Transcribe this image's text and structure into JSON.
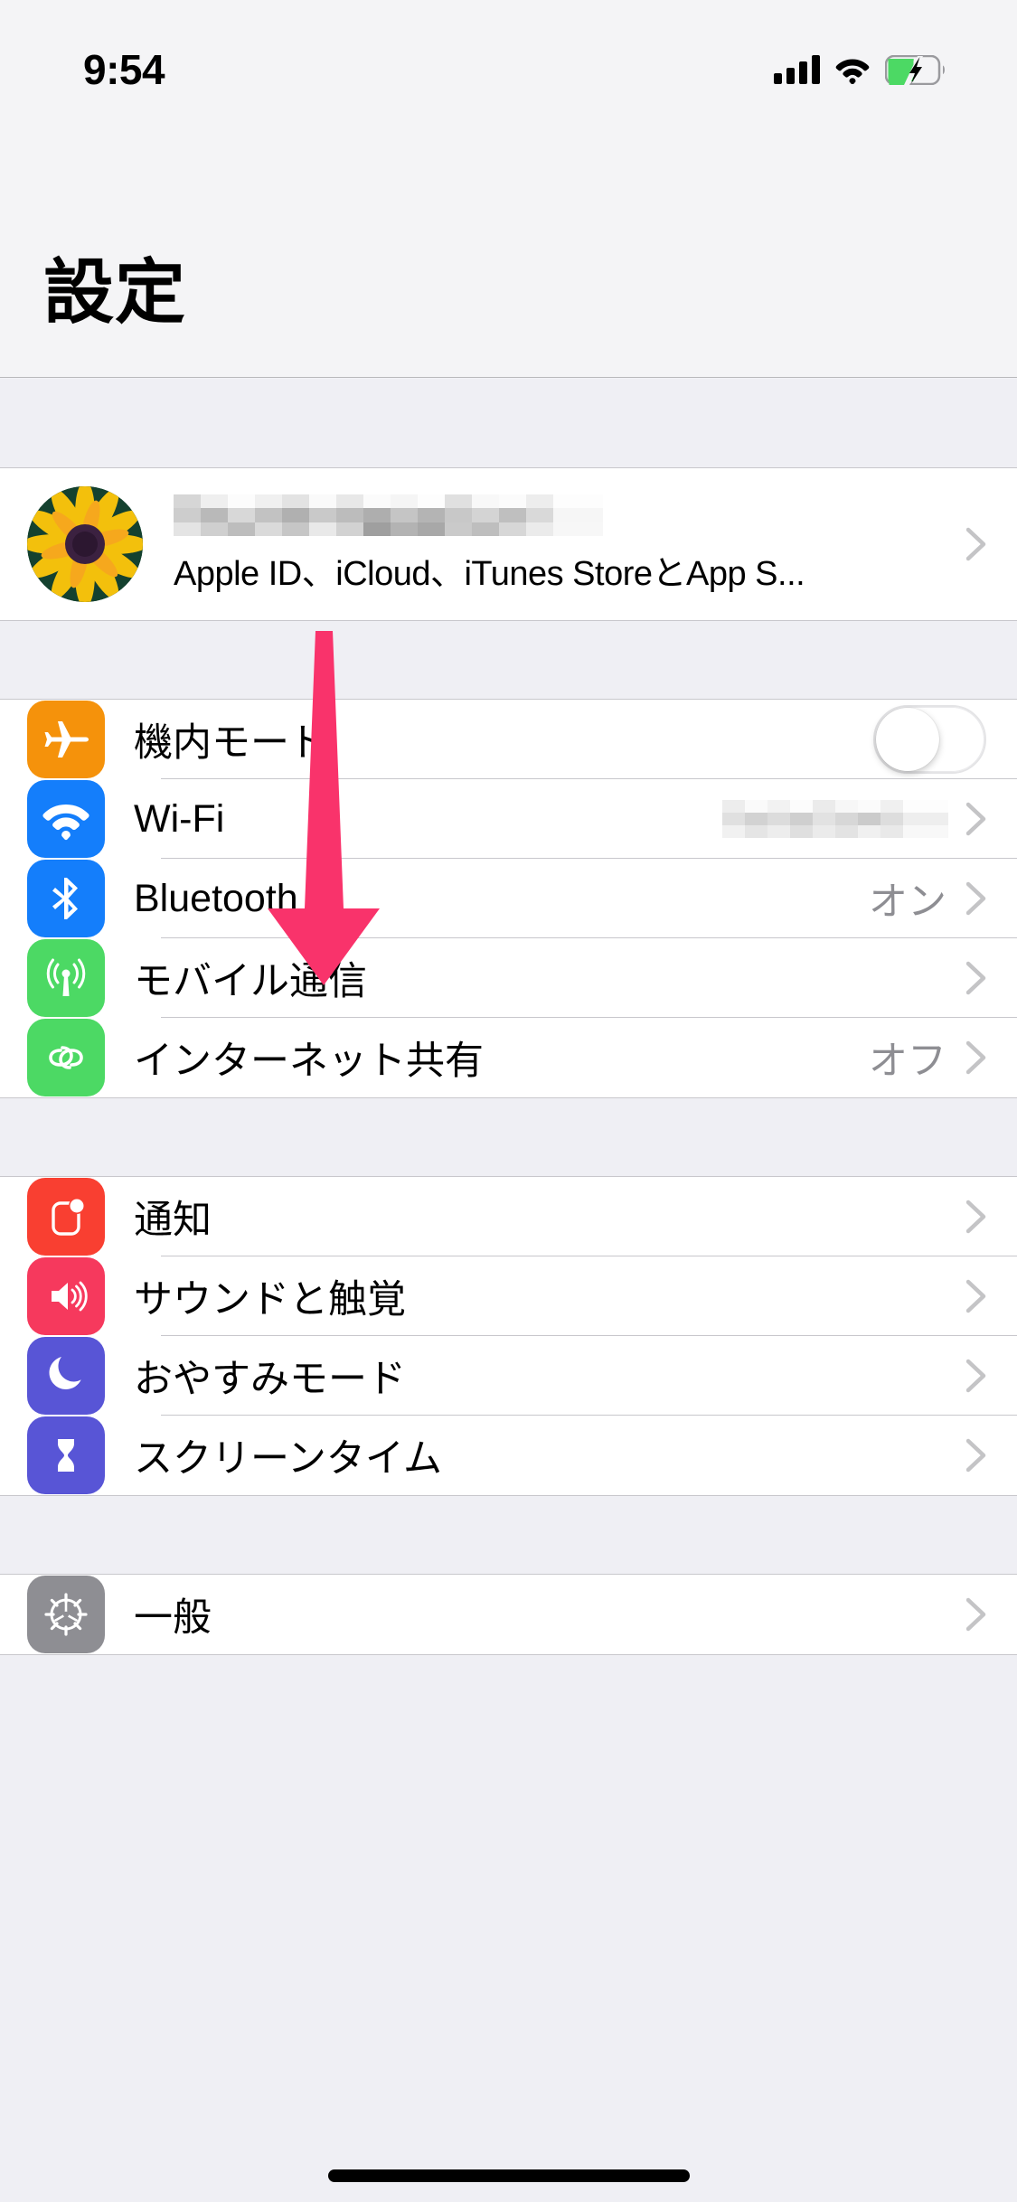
{
  "status_bar": {
    "time": "9:54",
    "signal_icon": "cellular-bars-icon",
    "wifi_icon": "wifi-icon",
    "battery_icon": "battery-charging-icon",
    "battery_color": "#4cd964"
  },
  "header": {
    "title": "設定"
  },
  "apple_id": {
    "avatar_icon": "sunflower-avatar",
    "name": "",
    "name_redacted": true,
    "subtitle": "Apple ID、iCloud、iTunes StoreとApp S...",
    "chevron_icon": "chevron-right-icon"
  },
  "groups": [
    {
      "id": "connectivity",
      "rows": [
        {
          "id": "airplane-mode",
          "label": "機内モード",
          "icon": "airplane-icon",
          "icon_color": "#f5920b",
          "control": "toggle",
          "toggle_on": false,
          "value": ""
        },
        {
          "id": "wifi",
          "label": "Wi-Fi",
          "icon": "wifi-icon",
          "icon_color": "#147efb",
          "control": "chevron",
          "value": "",
          "value_redacted": true
        },
        {
          "id": "bluetooth",
          "label": "Bluetooth",
          "icon": "bluetooth-icon",
          "icon_color": "#147efb",
          "control": "chevron",
          "value": "オン"
        },
        {
          "id": "cellular",
          "label": "モバイル通信",
          "icon": "cellular-antenna-icon",
          "icon_color": "#4cd964",
          "control": "chevron",
          "value": ""
        },
        {
          "id": "personal-hotspot",
          "label": "インターネット共有",
          "icon": "hotspot-link-icon",
          "icon_color": "#4cd964",
          "control": "chevron",
          "value": "オフ"
        }
      ]
    },
    {
      "id": "notifications",
      "rows": [
        {
          "id": "notifications",
          "label": "通知",
          "icon": "notification-badge-icon",
          "icon_color": "#f93f31",
          "control": "chevron",
          "value": ""
        },
        {
          "id": "sounds-haptics",
          "label": "サウンドと触覚",
          "icon": "speaker-waves-icon",
          "icon_color": "#f6395d",
          "control": "chevron",
          "value": ""
        },
        {
          "id": "do-not-disturb",
          "label": "おやすみモード",
          "icon": "moon-icon",
          "icon_color": "#5855d6",
          "control": "chevron",
          "value": ""
        },
        {
          "id": "screen-time",
          "label": "スクリーンタイム",
          "icon": "hourglass-icon",
          "icon_color": "#5855d6",
          "control": "chevron",
          "value": ""
        }
      ]
    },
    {
      "id": "system",
      "rows": [
        {
          "id": "general",
          "label": "一般",
          "icon": "gear-icon",
          "icon_color": "#8e8e93",
          "control": "chevron",
          "value": ""
        }
      ]
    }
  ],
  "annotation": {
    "arrow_icon": "down-arrow-annotation",
    "arrow_color": "#f9336b"
  }
}
